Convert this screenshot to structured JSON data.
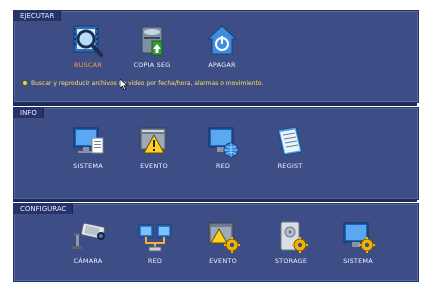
{
  "sections": {
    "ejecutar": {
      "title": "EJECUTAR",
      "items": [
        {
          "label": "BUSCAR",
          "icon": "search-film-icon"
        },
        {
          "label": "COPIA SEG",
          "icon": "backup-icon"
        },
        {
          "label": "APAGAR",
          "icon": "shutdown-icon"
        }
      ],
      "hint": "Buscar y reproducir archivos de video por fecha/hora, alarmas o movimiento."
    },
    "info": {
      "title": "INFO",
      "items": [
        {
          "label": "SISTEMA",
          "icon": "system-monitor-icon"
        },
        {
          "label": "EVENTO",
          "icon": "event-warning-icon"
        },
        {
          "label": "RED",
          "icon": "network-globe-icon"
        },
        {
          "label": "REGIST",
          "icon": "log-document-icon"
        }
      ]
    },
    "configurac": {
      "title": "CONFIGURAC",
      "items": [
        {
          "label": "CÁMARA",
          "icon": "camera-icon"
        },
        {
          "label": "RED",
          "icon": "network-config-icon"
        },
        {
          "label": "EVENTO",
          "icon": "event-config-icon"
        },
        {
          "label": "STORAGE",
          "icon": "storage-config-icon"
        },
        {
          "label": "SISTEMA",
          "icon": "system-config-icon"
        }
      ]
    }
  },
  "colors": {
    "panel_bg": "#3d4d86",
    "title_bg": "#26336a",
    "label_text": "#eef2ff",
    "active_label": "#ff9a3a",
    "hint_text": "#ffe25a"
  }
}
